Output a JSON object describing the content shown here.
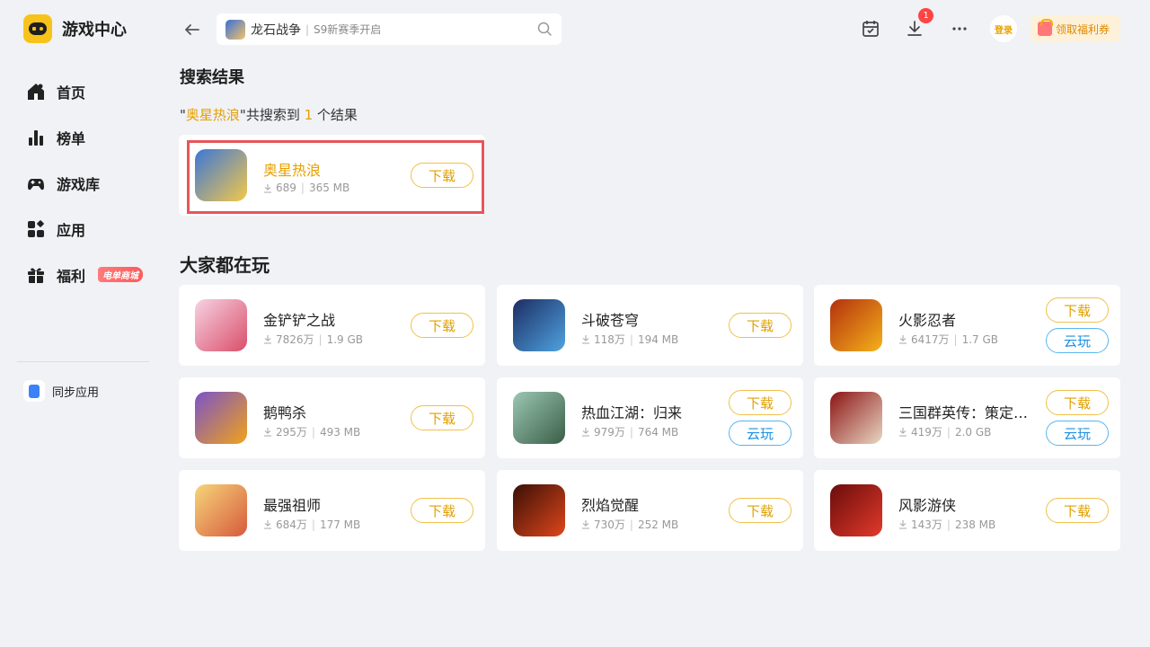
{
  "app": {
    "title": "游戏中心"
  },
  "sidebar": {
    "items": [
      {
        "label": "首页",
        "icon": "home-icon"
      },
      {
        "label": "榜单",
        "icon": "rank-icon"
      },
      {
        "label": "游戏库",
        "icon": "gamepad-icon"
      },
      {
        "label": "应用",
        "icon": "apps-icon"
      },
      {
        "label": "福利",
        "icon": "gift-icon",
        "badge": "电单商城"
      }
    ],
    "sync_label": "同步应用"
  },
  "topbar": {
    "search_game": "龙石战争",
    "search_sub": "S9新赛季开启",
    "download_count": "1",
    "login_label": "登录",
    "coupon_label": "领取福利券"
  },
  "search_section": {
    "title": "搜索结果",
    "quote_open": "\"",
    "keyword": "奥星热浪",
    "quote_close": "\"",
    "text_before_count": "共搜索到 ",
    "count": "1",
    "text_after_count": " 个结果",
    "result": {
      "name": "奥星热浪",
      "downloads": "689",
      "size": "365 MB",
      "btn": "下载",
      "colors": [
        "#3b77d8",
        "#f4c84a"
      ]
    }
  },
  "play_section": {
    "title": "大家都在玩",
    "games": [
      {
        "name": "金铲铲之战",
        "downloads": "7826万",
        "size": "1.9 GB",
        "download_btn": "下载",
        "cloud_btn": "",
        "colors": [
          "#f7d2e2",
          "#d94f6a"
        ]
      },
      {
        "name": "斗破苍穹",
        "downloads": "118万",
        "size": "194 MB",
        "download_btn": "下载",
        "cloud_btn": "",
        "colors": [
          "#1c2d63",
          "#4fa3e0"
        ]
      },
      {
        "name": "火影忍者",
        "downloads": "6417万",
        "size": "1.7 GB",
        "download_btn": "下载",
        "cloud_btn": "云玩",
        "colors": [
          "#b3300d",
          "#f5b21b"
        ]
      },
      {
        "name": "鹅鸭杀",
        "downloads": "295万",
        "size": "493 MB",
        "download_btn": "下载",
        "cloud_btn": "",
        "colors": [
          "#7a53c8",
          "#f1a21a"
        ]
      },
      {
        "name": "热血江湖：归来",
        "downloads": "979万",
        "size": "764 MB",
        "download_btn": "下载",
        "cloud_btn": "云玩",
        "colors": [
          "#9bc7b3",
          "#3a5e47"
        ]
      },
      {
        "name": "三国群英传：策定九州",
        "downloads": "419万",
        "size": "2.0 GB",
        "download_btn": "下载",
        "cloud_btn": "云玩",
        "colors": [
          "#8c1414",
          "#e9d7c3"
        ]
      },
      {
        "name": "最强祖师",
        "downloads": "684万",
        "size": "177 MB",
        "download_btn": "下载",
        "cloud_btn": "",
        "colors": [
          "#f6d57a",
          "#d75a3c"
        ]
      },
      {
        "name": "烈焰觉醒",
        "downloads": "730万",
        "size": "252 MB",
        "download_btn": "下载",
        "cloud_btn": "",
        "colors": [
          "#3a1006",
          "#e0461b"
        ]
      },
      {
        "name": "风影游侠",
        "downloads": "143万",
        "size": "238 MB",
        "download_btn": "下载",
        "cloud_btn": "",
        "colors": [
          "#6a0c0c",
          "#e23a2a"
        ]
      }
    ]
  }
}
